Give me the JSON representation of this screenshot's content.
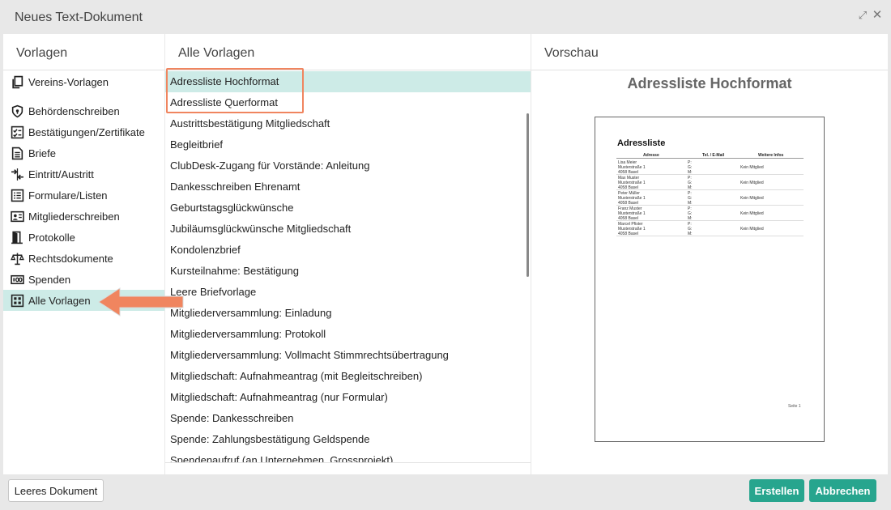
{
  "window": {
    "title": "Neues Text-Dokument",
    "expand_icon": "expand-icon",
    "close_icon": "close-icon"
  },
  "left_panel": {
    "header": "Vorlagen",
    "items": [
      {
        "label": "Vereins-Vorlagen",
        "icon": "copy-icon"
      },
      {
        "label": "Behördenschreiben",
        "icon": "shield-icon"
      },
      {
        "label": "Bestätigungen/Zertifikate",
        "icon": "checklist-icon"
      },
      {
        "label": "Briefe",
        "icon": "document-icon"
      },
      {
        "label": "Eintritt/Austritt",
        "icon": "arrows-icon"
      },
      {
        "label": "Formulare/Listen",
        "icon": "list-icon"
      },
      {
        "label": "Mitgliederschreiben",
        "icon": "id-card-icon"
      },
      {
        "label": "Protokolle",
        "icon": "door-icon"
      },
      {
        "label": "Rechtsdokumente",
        "icon": "scales-icon"
      },
      {
        "label": "Spenden",
        "icon": "money-icon"
      },
      {
        "label": "Alle Vorlagen",
        "icon": "grid-icon",
        "active": true
      }
    ]
  },
  "middle_panel": {
    "header": "Alle Vorlagen",
    "selected_index": 0,
    "items": [
      "Adressliste Hochformat",
      "Adressliste Querformat",
      "Austrittsbestätigung Mitgliedschaft",
      "Begleitbrief",
      "ClubDesk-Zugang für Vorstände: Anleitung",
      "Dankesschreiben Ehrenamt",
      "Geburtstagsglückwünsche",
      "Jubiläumsglückwünsche Mitgliedschaft",
      "Kondolenzbrief",
      "Kursteilnahme: Bestätigung",
      "Leere Briefvorlage",
      "Mitgliederversammlung: Einladung",
      "Mitgliederversammlung: Protokoll",
      "Mitgliederversammlung: Vollmacht Stimmrechtsübertragung",
      "Mitgliedschaft: Aufnahmeantrag (mit Begleitschreiben)",
      "Mitgliedschaft: Aufnahmeantrag (nur Formular)",
      "Spende: Dankesschreiben",
      "Spende: Zahlungsbestätigung Geldspende",
      "Spendenaufruf (an Unternehmen, Grossprojekt)"
    ]
  },
  "right_panel": {
    "header": "Vorschau",
    "preview_title": "Adressliste Hochformat",
    "document": {
      "heading": "Adressliste",
      "columns": [
        "Adresse",
        "Tel. / E-Mail",
        "Weitere Infos"
      ],
      "rows": [
        {
          "name": "Lisa Meier",
          "street": "Musterstraße 1",
          "city": "4058 Basel",
          "info": "Kein Mitglied"
        },
        {
          "name": "Max Muster",
          "street": "Musterstraße 1",
          "city": "4058 Basel",
          "info": "Kein Mitglied"
        },
        {
          "name": "Peter Müller",
          "street": "Musterstraße 1",
          "city": "4058 Basel",
          "info": "Kein Mitglied"
        },
        {
          "name": "Franz Muster",
          "street": "Musterstraße 1",
          "city": "4058 Basel",
          "info": "Kein Mitglied"
        },
        {
          "name": "Marcel Pfister",
          "street": "Musterstraße 1",
          "city": "4058 Basel",
          "info": "Kein Mitglied"
        }
      ],
      "contact_labels": [
        "P:",
        "G:",
        "M:"
      ],
      "footer": "Seite 1"
    }
  },
  "buttons": {
    "empty_document": "Leeres Dokument",
    "create": "Erstellen",
    "cancel": "Abbrechen"
  },
  "colors": {
    "accent": "#27a58e",
    "selection": "#cdebe7",
    "annotation": "#f0855f"
  }
}
